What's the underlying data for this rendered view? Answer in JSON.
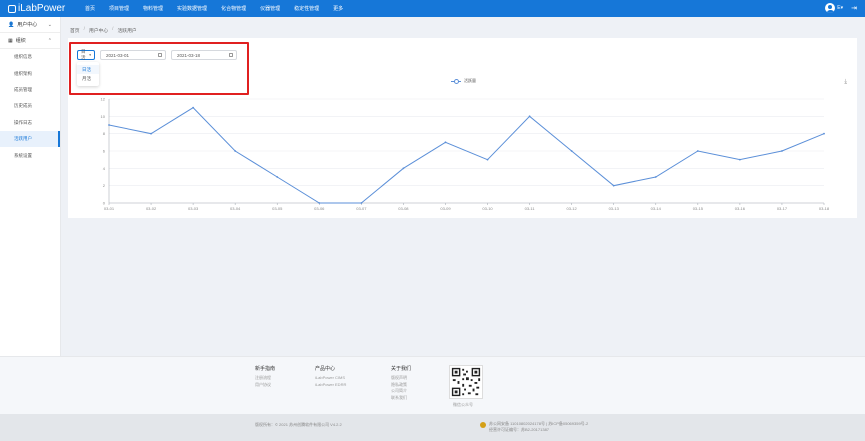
{
  "header": {
    "logo_text": "iLabPower",
    "nav": [
      "首页",
      "项目管理",
      "物料管理",
      "实验数据管理",
      "化合物管理",
      "仪器管理",
      "稳定性管理",
      "更多"
    ],
    "user_name": "E",
    "user_caret": "▾"
  },
  "sidebar": {
    "groups": [
      {
        "label": "用户中心",
        "icon": "user-icon",
        "expanded": false
      },
      {
        "label": "组织",
        "icon": "org-icon",
        "expanded": true
      }
    ],
    "items": [
      {
        "label": "组织信息",
        "active": false
      },
      {
        "label": "组织架构",
        "active": false
      },
      {
        "label": "成员管理",
        "active": false
      },
      {
        "label": "历史成员",
        "active": false
      },
      {
        "label": "操作日志",
        "active": false
      },
      {
        "label": "活跃用户",
        "active": true
      },
      {
        "label": "系统设置",
        "active": false
      }
    ]
  },
  "breadcrumb": [
    "首页",
    "用户中心",
    "活跃用户"
  ],
  "filters": {
    "period_value": "日活",
    "period_caret": "▾",
    "start_date": "2021-03-01",
    "end_date": "2021-03-18",
    "dropdown_options": [
      "日活",
      "月活"
    ],
    "dropdown_selected": "日活"
  },
  "chart_data": {
    "type": "line",
    "legend": [
      "活跃量"
    ],
    "categories": [
      "03-01",
      "03-02",
      "03-03",
      "03-04",
      "03-05",
      "03-06",
      "03-07",
      "03-08",
      "03-09",
      "03-10",
      "03-11",
      "03-12",
      "03-13",
      "03-14",
      "03-15",
      "03-16",
      "03-17",
      "03-18"
    ],
    "series": [
      {
        "name": "活跃量",
        "values": [
          9,
          8,
          11,
          6,
          3,
          0,
          0,
          4,
          7,
          5,
          10,
          6,
          2,
          3,
          6,
          5,
          6,
          8
        ]
      }
    ],
    "ylim": [
      0,
      12
    ],
    "yticks": [
      0,
      2,
      4,
      6,
      8,
      10,
      12
    ],
    "grid": true,
    "legend_position": "top-center",
    "line_color": "#5b8fd8"
  },
  "footer": {
    "columns": [
      {
        "title": "新手指南",
        "links": [
          "注册流程",
          "用户协议"
        ]
      },
      {
        "title": "产品中心",
        "links": [
          "iLabPower CIMS",
          "iLabPower EDRR"
        ]
      },
      {
        "title": "关于我们",
        "links": [
          "版权声明",
          "隐私政策",
          "公司简介",
          "联系我们"
        ]
      }
    ],
    "qr_caption": "微信公众号",
    "copyright": "版权所有：© 2021 苏州创腾软件有限公司 V4.2.2",
    "record_line1": "苏公网安备 11010802024178号 | 苏ICP备05069359号-2",
    "record_line2": "经营许可证编号：苏B2-20171387"
  },
  "colors": {
    "brand": "#1677d8",
    "highlight": "#e02020"
  }
}
